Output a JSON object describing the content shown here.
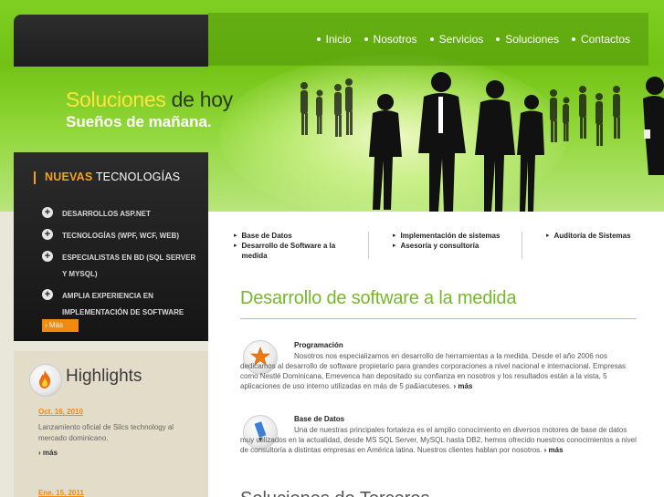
{
  "nav": {
    "items": [
      {
        "label": "Inicio"
      },
      {
        "label": "Nosotros"
      },
      {
        "label": "Servicios"
      },
      {
        "label": "Soluciones"
      },
      {
        "label": "Contactos"
      }
    ]
  },
  "hero": {
    "line1_a": "Soluciones",
    "line1_b": "de hoy",
    "line2": "Sueños de mañana."
  },
  "tech": {
    "title_highlight": "NUEVAS",
    "title_rest": "TECNOLOGÍAS",
    "items": [
      {
        "label": "DESARROLLOS ASP.NET"
      },
      {
        "label": "TECNOLOGÍAS (WPF, WCF, WEB)"
      },
      {
        "label": "ESPECIALISTAS EN BD (SQL SERVER Y MYSQL)"
      },
      {
        "label": "AMPLIA EXPERIENCIA EN IMPLEMENTACIÓN DE SOFTWARE"
      }
    ],
    "more": "› Más"
  },
  "highlights": {
    "title": "Highlights",
    "items": [
      {
        "date": "Oct. 16, 2010",
        "text": "Lanzamiento oficial de Silcs technology al mercado dominicano.",
        "more": "› más"
      },
      {
        "date": "Ene. 15, 2011"
      }
    ]
  },
  "submenu": {
    "col1": [
      "Base de Datos",
      "Desarrollo de Software a la medida"
    ],
    "col2": [
      "Implementación de sistemas",
      "Asesoría y consultoría"
    ],
    "col3": [
      "Auditoría de Sistemas"
    ]
  },
  "main": {
    "heading": "Desarrollo de software a la medida",
    "services": [
      {
        "title": "Programación",
        "text": "Nosotros nos especializamos en desarrollo de herramientas a la medida. Desde el año 2006 nos dedicamos al desarrollo de software propietario para grandes corporaciones a nivel nacional e internacional. Empresas como Nestlé Dominicana, Emevenca han depositado su confianza en nosotros y los resultados están a la vista, 5 aplicaciones de uso interno utilizadas en más de 5 pa&iacuteses.",
        "more": "› más"
      },
      {
        "title": "Base de Datos",
        "text": "Una de nuestras principales fortaleza es el amplio conocimiento en diversos motores de base de datos muy utilizados en la actualidad, desde MS SQL Server, MySQL hasta DB2, hemos ofrecido nuestros conocimientos a nivel de consultoría a distintas empresas en América latina. Nuestros clientes hablan por nosotros.",
        "more": "› más"
      }
    ],
    "heading2": "Soluciones de Terceros"
  }
}
